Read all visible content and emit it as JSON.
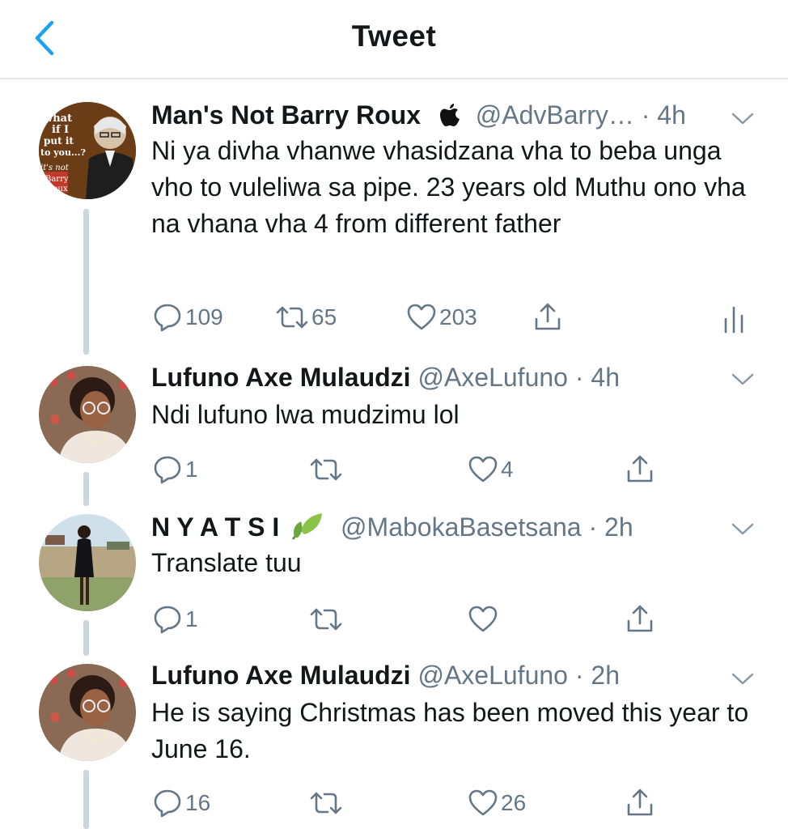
{
  "header": {
    "title": "Tweet"
  },
  "tweets": [
    {
      "name": "Man's Not Barry Roux",
      "handle": "@AdvBarry…",
      "sep": "·",
      "time": "4h",
      "text": "Ni ya divha vhanwe vhasidzana vha to beba unga vho to vuleliwa sa pipe. 23 years old Muthu ono vha na vhana vha 4 from different father",
      "replies": "109",
      "retweets": "65",
      "likes": "203",
      "avatar_text": [
        "what",
        "if I",
        "put it",
        "to you...?",
        "it's not",
        "Barry",
        "Roux"
      ]
    },
    {
      "name": "Lufuno Axe Mulaudzi",
      "handle": "@AxeLufuno",
      "sep": "·",
      "time": "4h",
      "text": "Ndi lufuno lwa mudzimu lol",
      "replies": "1",
      "retweets": "",
      "likes": "4"
    },
    {
      "name": "N Y A T S I",
      "handle": "@MabokaBasetsana",
      "sep": "·",
      "time": "2h",
      "text": "Translate tuu",
      "replies": "1",
      "retweets": "",
      "likes": ""
    },
    {
      "name": "Lufuno Axe Mulaudzi",
      "handle": "@AxeLufuno",
      "sep": "·",
      "time": "2h",
      "text": "He is saying Christmas has been moved this year to June 16.",
      "replies": "16",
      "retweets": "",
      "likes": "26"
    }
  ],
  "colors": {
    "accent": "#1da1f2",
    "text": "#14171a",
    "secondary": "#657786",
    "line": "#ccd6dd"
  }
}
